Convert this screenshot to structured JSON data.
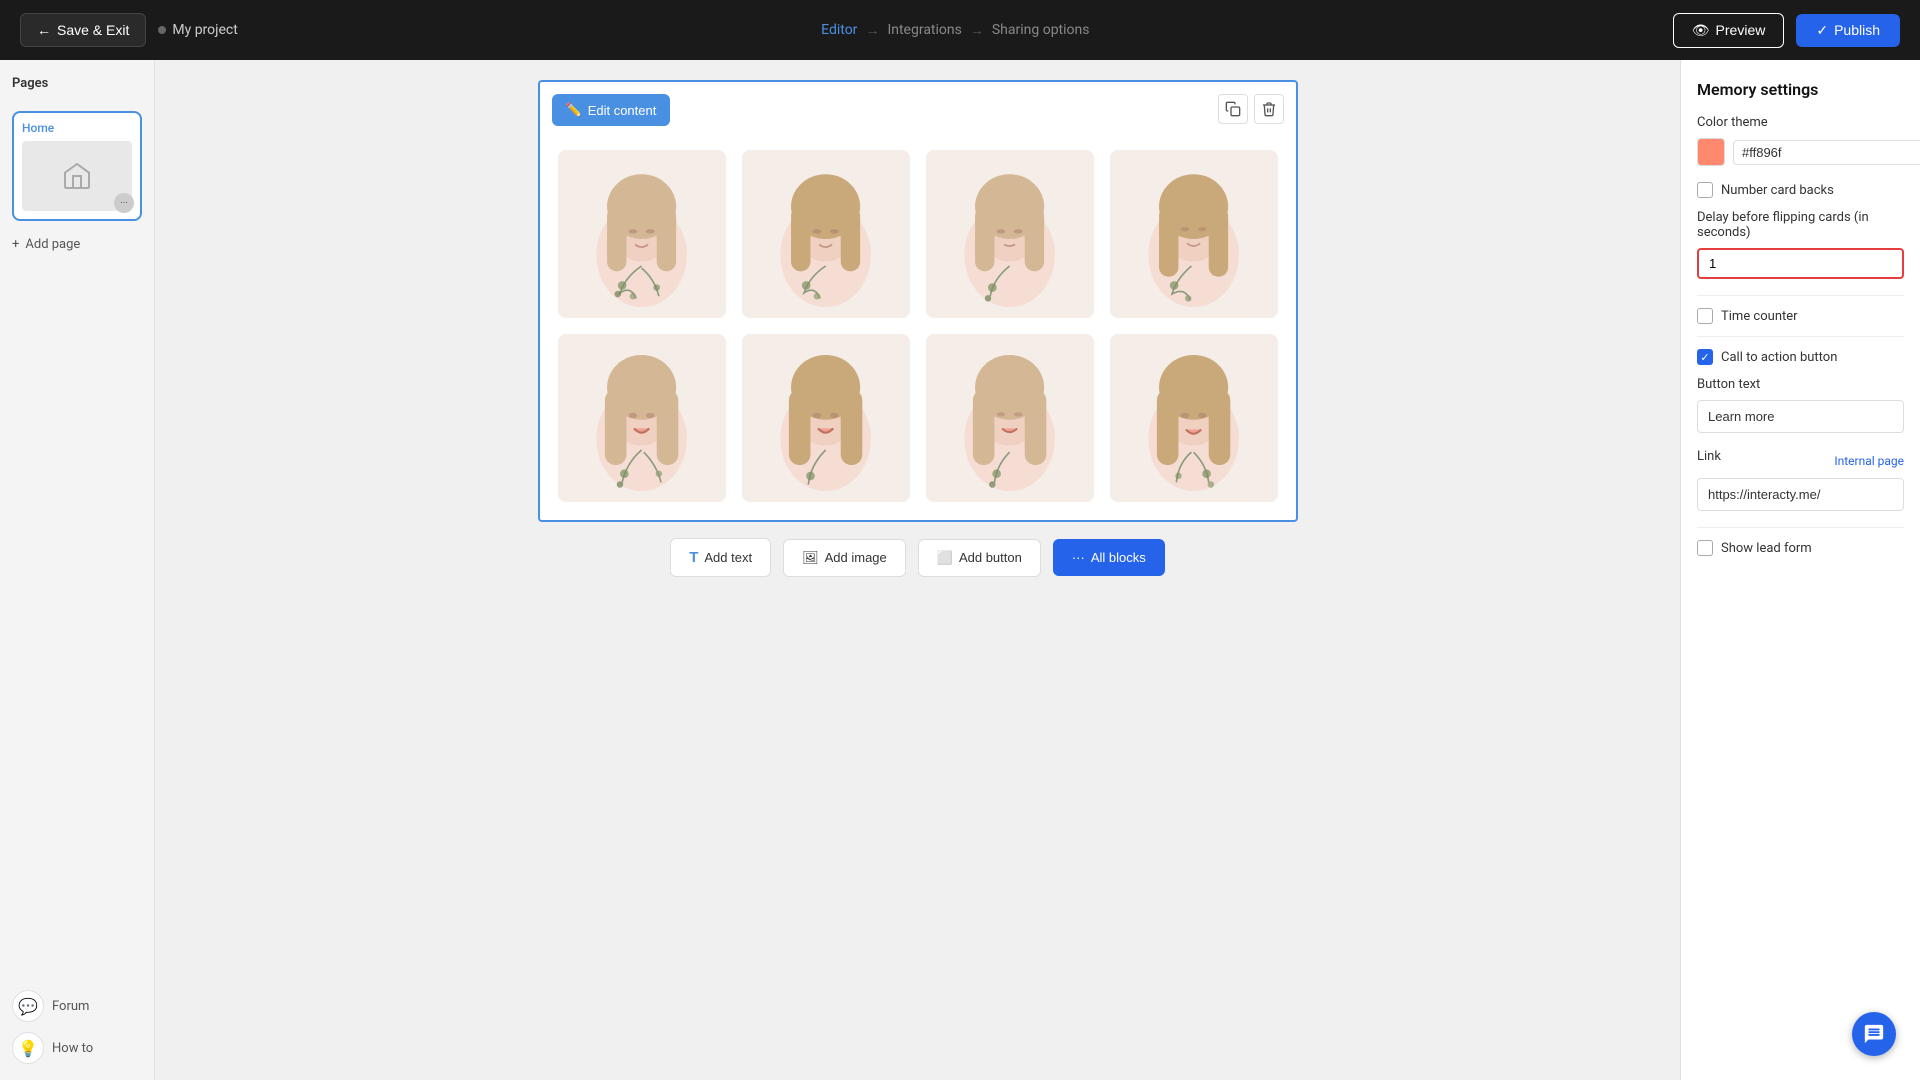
{
  "header": {
    "save_exit_label": "Save & Exit",
    "project_name": "My project",
    "nav_steps": [
      {
        "label": "Editor",
        "active": true
      },
      {
        "label": "Integrations",
        "active": false
      },
      {
        "label": "Sharing options",
        "active": false
      }
    ],
    "preview_label": "Preview",
    "publish_label": "Publish"
  },
  "sidebar": {
    "title": "Pages",
    "pages": [
      {
        "name": "Home"
      }
    ],
    "add_page_label": "Add page",
    "bottom_items": [
      {
        "icon": "💬",
        "label": "Forum"
      },
      {
        "icon": "💡",
        "label": "How to"
      }
    ]
  },
  "canvas": {
    "edit_content_label": "Edit content",
    "copy_icon": "copy",
    "delete_icon": "delete",
    "card_count": 8
  },
  "add_blocks": {
    "items": [
      {
        "label": "Add text",
        "icon": "T"
      },
      {
        "label": "Add image",
        "icon": "🖼"
      },
      {
        "label": "Add button",
        "icon": "⬜"
      },
      {
        "label": "All blocks",
        "icon": "···",
        "primary": true
      }
    ]
  },
  "right_panel": {
    "title": "Memory settings",
    "color_theme_label": "Color theme",
    "color_value": "#ff896f",
    "color_hex": "#ff896f",
    "number_card_backs_label": "Number card backs",
    "number_card_backs_checked": false,
    "delay_label": "Delay before flipping cards (in seconds)",
    "delay_value": "1",
    "time_counter_label": "Time counter",
    "time_counter_checked": false,
    "call_to_action_label": "Call to action button",
    "call_to_action_checked": true,
    "button_text_label": "Button text",
    "button_text_value": "Learn more",
    "link_label": "Link",
    "internal_page_label": "Internal page",
    "link_value": "https://interacty.me/",
    "show_lead_form_label": "Show lead form",
    "show_lead_form_checked": false
  },
  "chat_bubble": {
    "icon": "chat"
  }
}
